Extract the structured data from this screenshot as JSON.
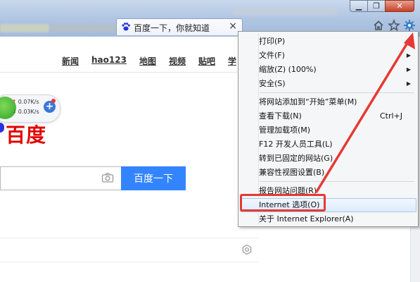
{
  "browser": {
    "tab_title": "百度一下，你就知道",
    "tab_close": "×",
    "window_controls": {
      "minimize": "▁",
      "restore": "❐",
      "close": "✕"
    }
  },
  "page": {
    "nav": [
      "新闻",
      "hao123",
      "地图",
      "视频",
      "贴吧",
      "学"
    ],
    "logo_text": "百度",
    "search_button": "百度一下"
  },
  "speed_widget": {
    "up_speed": "0.07K/s",
    "down_speed": "0.03K/s",
    "up_arrow": "↑",
    "down_arrow": "↓",
    "plus": "+"
  },
  "tools_menu": {
    "items": [
      {
        "label": "打印(P)",
        "submenu": true
      },
      {
        "label": "文件(F)",
        "submenu": true
      },
      {
        "label": "缩放(Z) (100%)",
        "submenu": true
      },
      {
        "label": "安全(S)",
        "submenu": true
      },
      {
        "label": "将网站添加到“开始”菜单(M)"
      },
      {
        "label": "查看下载(N)",
        "shortcut": "Ctrl+J"
      },
      {
        "label": "管理加载项(M)"
      },
      {
        "label": "F12 开发人员工具(L)"
      },
      {
        "label": "转到已固定的网站(G)"
      },
      {
        "label": "兼容性视图设置(B)"
      },
      {
        "label": "报告网站问题(R)"
      },
      {
        "label": "Internet 选项(O)",
        "highlighted": true
      },
      {
        "label": "关于 Internet Explorer(A)"
      }
    ],
    "submenu_glyph": "▶"
  },
  "icons": {
    "home": "home-icon",
    "favorites": "star-icon",
    "tools": "gear-icon",
    "camera": "camera-icon",
    "settings": "settings-icon"
  },
  "colors": {
    "baidu_red": "#e10602",
    "baidu_blue": "#3385ff",
    "annotation_red": "#e53935",
    "menu_highlight": "#dcebfc"
  }
}
